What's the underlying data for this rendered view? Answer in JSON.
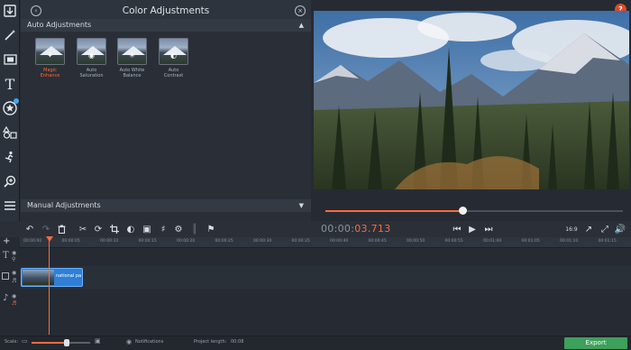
{
  "panel": {
    "title": "Color Adjustments",
    "back_icon": "back-arrow-icon",
    "close_icon": "close-icon",
    "auto_section": "Auto Adjustments",
    "manual_section": "Manual Adjustments",
    "presets": [
      {
        "label": "Magic Enhance",
        "icon": "magic-wand-icon",
        "active": true
      },
      {
        "label": "Auto Saturation",
        "icon": "saturation-icon",
        "active": false
      },
      {
        "label": "Auto White Balance",
        "icon": "white-balance-icon",
        "active": false
      },
      {
        "label": "Auto Contrast",
        "icon": "contrast-icon",
        "active": false
      }
    ]
  },
  "sidebar": {
    "tools": [
      "import-icon",
      "magic-wand-icon",
      "filter-icon",
      "titles-icon",
      "stickers-icon",
      "shapes-icon",
      "transitions-icon",
      "zoom-icon",
      "more-icon"
    ]
  },
  "player": {
    "timecode_prefix": "00:00:",
    "timecode_current": "03.713",
    "progress": 0.46,
    "aspect": "16:9"
  },
  "help_label": "?",
  "timeline": {
    "ticks": [
      "00:00:00",
      "00:00:05",
      "00:00:10",
      "00:00:15",
      "00:00:20",
      "00:00:25",
      "00:00:30",
      "00:00:35",
      "00:00:40",
      "00:00:45",
      "00:00:50",
      "00:00:55",
      "00:01:00",
      "00:01:05",
      "00:01:10",
      "00:01:15"
    ],
    "clip_name": "national pa"
  },
  "status": {
    "scale_label": "Scale:",
    "scale_value": 0.6,
    "notifications": "Notifications",
    "project_length_label": "Project length:",
    "project_length": "00:08",
    "export_label": "Export"
  },
  "colors": {
    "accent": "#ff6a3d",
    "export": "#3da05b",
    "clip": "#2f7fd6"
  }
}
